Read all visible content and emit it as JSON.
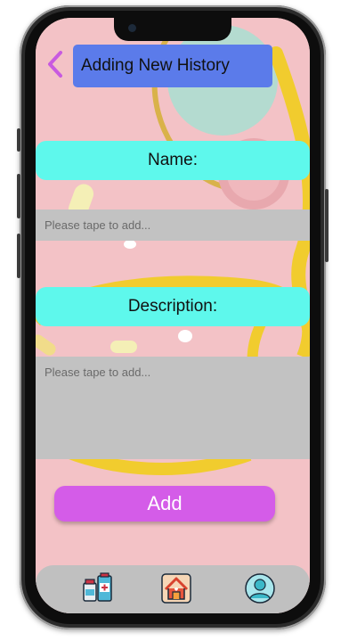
{
  "header": {
    "title": "Adding New History",
    "back_icon": "chevron-left-icon"
  },
  "form": {
    "name_label": "Name:",
    "name_placeholder": "Please tape to add...",
    "description_label": "Description:",
    "description_placeholder": "Please tape to add...",
    "add_button_label": "Add"
  },
  "bottom_nav": {
    "items": [
      {
        "icon": "medicine-icon"
      },
      {
        "icon": "home-icon"
      },
      {
        "icon": "user-avatar-icon"
      }
    ]
  },
  "colors": {
    "title_bg": "#5b7bea",
    "label_bg": "#5ef8ec",
    "input_bg": "#c2c2c2",
    "add_button_bg": "#d45ce8",
    "back_arrow": "#c85ae0",
    "nav_bg": "#c0c0c0",
    "wallpaper": "#f3c2c6"
  }
}
